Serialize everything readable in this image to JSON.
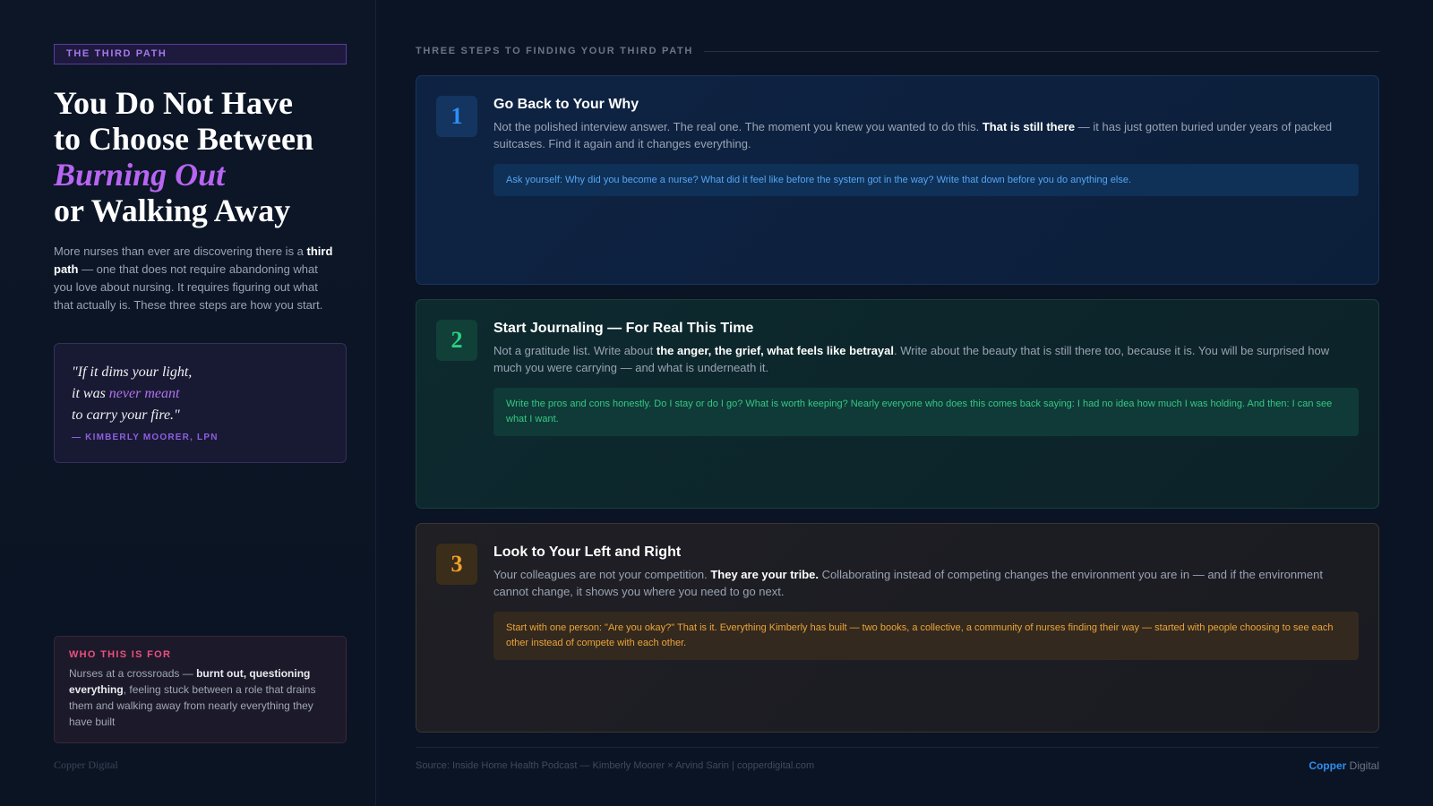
{
  "sidebar": {
    "tag": "THE THIRD PATH",
    "headline": {
      "line1": "You Do Not Have",
      "line2": "to Choose Between",
      "highlight": "Burning Out",
      "line4": "or Walking Away"
    },
    "intro": {
      "pre": "More nurses than ever are discovering there is a ",
      "bold": "third path",
      "post": " — one that does not require abandoning what you love about nursing. It requires figuring out what that actually is. These three steps are how you start."
    },
    "quote": {
      "line1": "\"If it dims your light,",
      "line2_pre": "it was ",
      "line2_accent": "never meant",
      "line3": "to carry your fire.\"",
      "attribution": "— KIMBERLY MOORER, LPN"
    },
    "who": {
      "title": "WHO THIS IS FOR",
      "pre": "Nurses at a crossroads — ",
      "bold": "burnt out, questioning everything",
      "post": ", feeling stuck between a role that drains them and walking away from nearly everything they have built"
    },
    "brand": "Copper Digital"
  },
  "main": {
    "section_title": "THREE STEPS TO FINDING YOUR THIRD PATH",
    "steps": [
      {
        "number": "1",
        "title": "Go Back to Your Why",
        "text_pre": "Not the polished interview answer. The real one. The moment you knew you wanted to do this. ",
        "text_bold": "That is still there",
        "text_post": " — it has just gotten buried under years of packed suitcases. Find it again and it changes everything.",
        "callout": "Ask yourself: Why did you become a nurse? What did it feel like before the system got in the way? Write that down before you do anything else."
      },
      {
        "number": "2",
        "title": "Start Journaling — For Real This Time",
        "text_pre": "Not a gratitude list. Write about ",
        "text_bold": "the anger, the grief, what feels like betrayal",
        "text_post": ". Write about the beauty that is still there too, because it is. You will be surprised how much you were carrying — and what is underneath it.",
        "callout": "Write the pros and cons honestly. Do I stay or do I go? What is worth keeping? Nearly everyone who does this comes back saying: I had no idea how much I was holding. And then: I can see what I want."
      },
      {
        "number": "3",
        "title": "Look to Your Left and Right",
        "text_pre": "Your colleagues are not your competition. ",
        "text_bold": "They are your tribe.",
        "text_post": " Collaborating instead of competing changes the environment you are in — and if the environment cannot change, it shows you where you need to go next.",
        "callout": "Start with one person: \"Are you okay?\" That is it. Everything Kimberly has built — two books, a collective, a community of nurses finding their way — started with people choosing to see each other instead of compete with each other."
      }
    ]
  },
  "footer": {
    "source": "Source: Inside Home Health Podcast — Kimberly Moorer × Arvind Sarin | copperdigital.com",
    "brand_accent": "Copper",
    "brand_rest": " Digital"
  },
  "colors": {
    "background": "#0b1424",
    "purple_accent": "#b765f2",
    "step1_accent": "#2f8ff7",
    "step2_accent": "#2bd082",
    "step3_accent": "#f0a02a",
    "pink_accent": "#ee4f7d"
  }
}
